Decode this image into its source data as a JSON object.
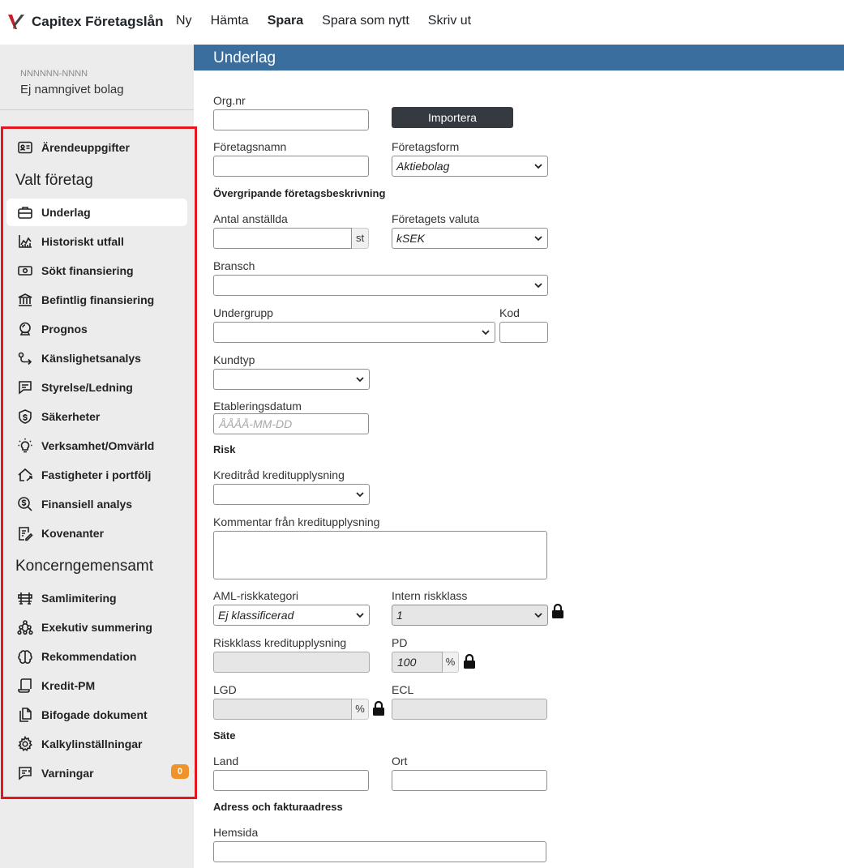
{
  "app": {
    "brand": "Capitex Företagslån",
    "menu": [
      "Ny",
      "Hämta",
      "Spara",
      "Spara som nytt",
      "Skriv ut"
    ]
  },
  "sidebar": {
    "company_id": "NNNNNN-NNNN",
    "company_name": "Ej namngivet bolag",
    "top_item": {
      "label": "Ärendeuppgifter",
      "icon": "id-card-icon"
    },
    "section1": "Valt företag",
    "items1": [
      {
        "label": "Underlag",
        "icon": "briefcase-icon",
        "active": true
      },
      {
        "label": "Historiskt utfall",
        "icon": "chart-icon"
      },
      {
        "label": "Sökt finansiering",
        "icon": "banknote-icon"
      },
      {
        "label": "Befintlig finansiering",
        "icon": "bank-icon"
      },
      {
        "label": "Prognos",
        "icon": "crystal-ball-icon"
      },
      {
        "label": "Känslighetsanalys",
        "icon": "route-icon"
      },
      {
        "label": "Styrelse/Ledning",
        "icon": "message-icon"
      },
      {
        "label": "Säkerheter",
        "icon": "shield-dollar-icon"
      },
      {
        "label": "Verksamhet/Omvärld",
        "icon": "bulb-icon"
      },
      {
        "label": "Fastigheter i portfölj",
        "icon": "house-icon"
      },
      {
        "label": "Finansiell analys",
        "icon": "dollar-search-icon"
      },
      {
        "label": "Kovenanter",
        "icon": "contract-icon"
      }
    ],
    "section2": "Koncerngemensamt",
    "items2": [
      {
        "label": "Samlimitering",
        "icon": "barrier-icon"
      },
      {
        "label": "Exekutiv summering",
        "icon": "hierarchy-icon"
      },
      {
        "label": "Rekommendation",
        "icon": "brain-icon"
      },
      {
        "label": "Kredit-PM",
        "icon": "scroll-icon"
      },
      {
        "label": "Bifogade dokument",
        "icon": "documents-icon"
      },
      {
        "label": "Kalkylinställningar",
        "icon": "gear-icon"
      },
      {
        "label": "Varningar",
        "icon": "warning-message-icon",
        "badge": "0"
      }
    ]
  },
  "page": {
    "title": "Underlag",
    "org_nr_label": "Org.nr",
    "org_nr_value": "",
    "import_button": "Importera",
    "company_name_label": "Företagsnamn",
    "company_name_value": "",
    "company_form_label": "Företagsform",
    "company_form_value": "Aktiebolag",
    "overview_heading": "Övergripande företagsbeskrivning",
    "employees_label": "Antal anställda",
    "employees_value": "",
    "employees_unit": "st",
    "currency_label": "Företagets valuta",
    "currency_value": "kSEK",
    "industry_label": "Bransch",
    "industry_value": "",
    "subgroup_label": "Undergrupp",
    "subgroup_value": "",
    "code_label": "Kod",
    "code_value": "",
    "customer_type_label": "Kundtyp",
    "customer_type_value": "",
    "established_label": "Etableringsdatum",
    "established_placeholder": "ÅÅÅÅ-MM-DD",
    "risk_heading": "Risk",
    "credit_advice_label": "Kreditråd kreditupplysning",
    "credit_advice_value": "",
    "credit_comment_label": "Kommentar från kreditupplysning",
    "credit_comment_value": "",
    "aml_label": "AML-riskkategori",
    "aml_value": "Ej klassificerad",
    "internal_risk_label": "Intern riskklass",
    "internal_risk_value": "1",
    "risk_class_credit_label": "Riskklass kreditupplysning",
    "risk_class_credit_value": "",
    "pd_label": "PD",
    "pd_value": "100",
    "pd_unit": "%",
    "lgd_label": "LGD",
    "lgd_value": "",
    "lgd_unit": "%",
    "ecl_label": "ECL",
    "ecl_value": "",
    "seat_heading": "Säte",
    "country_label": "Land",
    "country_value": "",
    "city_label": "Ort",
    "city_value": "",
    "address_heading": "Adress och fakturaadress",
    "website_label": "Hemsida",
    "website_value": ""
  },
  "colors": {
    "header_blue": "#3a6e9e",
    "sidebar_bg": "#ececec",
    "highlight_red": "#e5161f",
    "badge_orange": "#f0932b",
    "button_dark": "#343a40"
  }
}
